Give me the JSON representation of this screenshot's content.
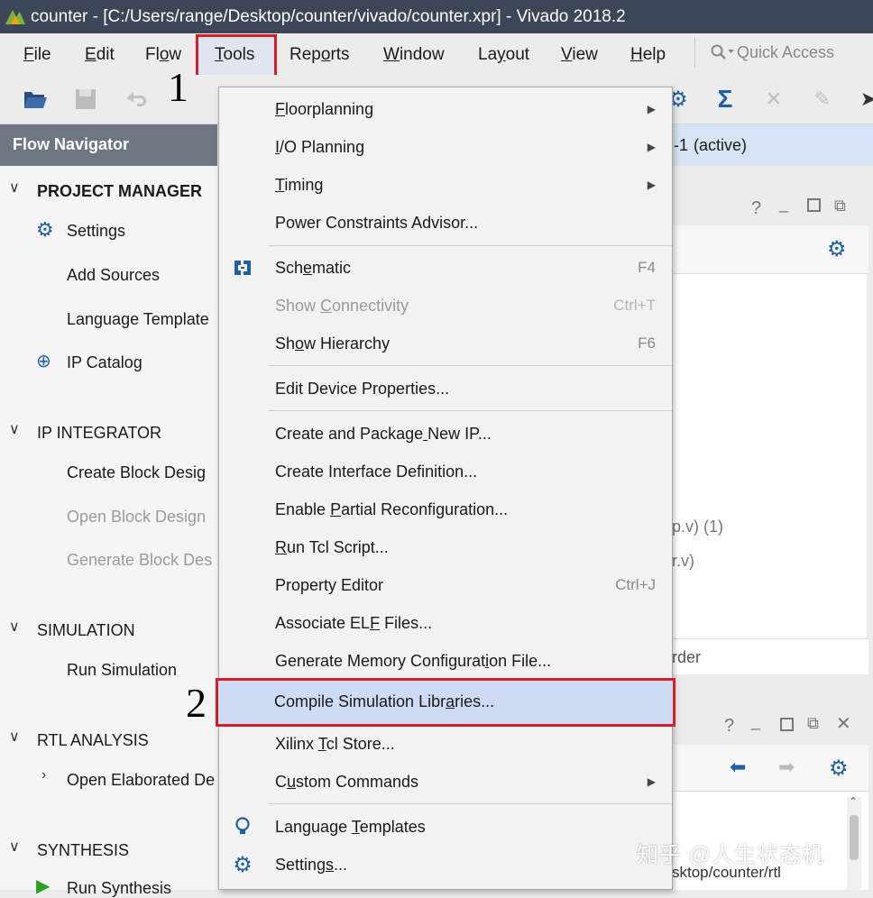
{
  "window": {
    "title": "counter - [C:/Users/range/Desktop/counter/vivado/counter.xpr] - Vivado 2018.2"
  },
  "menubar": {
    "items": [
      {
        "label": "File",
        "u": "F",
        "rest": "ile"
      },
      {
        "label": "Edit",
        "u": "E",
        "rest": "dit"
      },
      {
        "label": "Flow",
        "pre": "Fl",
        "u": "o",
        "rest": "w"
      },
      {
        "label": "Tools",
        "u": "T",
        "rest": "ools"
      },
      {
        "label": "Reports",
        "pre": "Rep",
        "u": "o",
        "rest": "rts"
      },
      {
        "label": "Window",
        "u": "W",
        "rest": "indow"
      },
      {
        "label": "Layout",
        "pre": "La",
        "u": "y",
        "rest": "out"
      },
      {
        "label": "View",
        "u": "V",
        "rest": "iew"
      },
      {
        "label": "Help",
        "u": "H",
        "rest": "elp"
      }
    ],
    "quick_access_placeholder": "Quick Access"
  },
  "annotations": {
    "step1": "1",
    "step2": "2"
  },
  "flow_navigator": {
    "title": "Flow Navigator",
    "project_manager": "PROJECT MANAGER",
    "settings": "Settings",
    "add_sources": "Add Sources",
    "language_templates": "Language Template",
    "ip_catalog": "IP Catalog",
    "ip_integrator": "IP INTEGRATOR",
    "create_block_design": "Create Block Desig",
    "open_block_design": "Open Block Design",
    "generate_block_design": "Generate Block Des",
    "simulation": "SIMULATION",
    "run_simulation": "Run Simulation",
    "rtl_analysis": "RTL ANALYSIS",
    "open_elaborated": "Open Elaborated De",
    "synthesis": "SYNTHESIS",
    "run_synthesis": "Run Synthesis"
  },
  "right": {
    "active_run": "-1",
    "active_label": "(active)",
    "src1": "p.v) (1)",
    "src2": "r.v)",
    "order": "rder",
    "path": "sktop/counter/rtl"
  },
  "tools_menu": {
    "items": [
      {
        "label": "Floorplanning",
        "u_index": 0,
        "submenu": true
      },
      {
        "label": "I/O Planning",
        "u_index": 0,
        "submenu": true
      },
      {
        "label": "Timing",
        "u_index": 0,
        "submenu": true
      },
      {
        "label": "Power Constraints Advisor..."
      },
      {
        "label": "Schematic",
        "u_index": 3,
        "shortcut": "F4"
      },
      {
        "label": "Show Connectivity",
        "u_index": 5,
        "shortcut": "Ctrl+T",
        "disabled": true
      },
      {
        "label": "Show Hierarchy",
        "u_index": 2,
        "shortcut": "F6"
      },
      {
        "label": "Edit Device Properties..."
      },
      {
        "label": "Create and Package New IP...",
        "u_index": 18
      },
      {
        "label": "Create Interface Definition..."
      },
      {
        "label": "Enable Partial Reconfiguration...",
        "u_index": 7
      },
      {
        "label": "Run Tcl Script...",
        "u_index": 0
      },
      {
        "label": "Property Editor",
        "shortcut": "Ctrl+J"
      },
      {
        "label": "Associate ELF Files...",
        "u_index": 12
      },
      {
        "label": "Generate Memory Configuration File...",
        "u_index": 26
      },
      {
        "label": "Compile Simulation Libraries...",
        "u_index": 23
      },
      {
        "label": "Xilinx Tcl Store...",
        "u_index": 7
      },
      {
        "label": "Custom Commands",
        "u_index": 1,
        "submenu": true
      },
      {
        "label": "Language Templates",
        "u_index": 9
      },
      {
        "label": "Settings...",
        "u_index": 7
      }
    ]
  },
  "watermark": "知乎 @人生状态机",
  "colors": {
    "accent_red": "#d21f2b",
    "highlight": "#cddcf4",
    "titlebar": "#3c4658",
    "icon_blue": "#1f5fa8"
  }
}
